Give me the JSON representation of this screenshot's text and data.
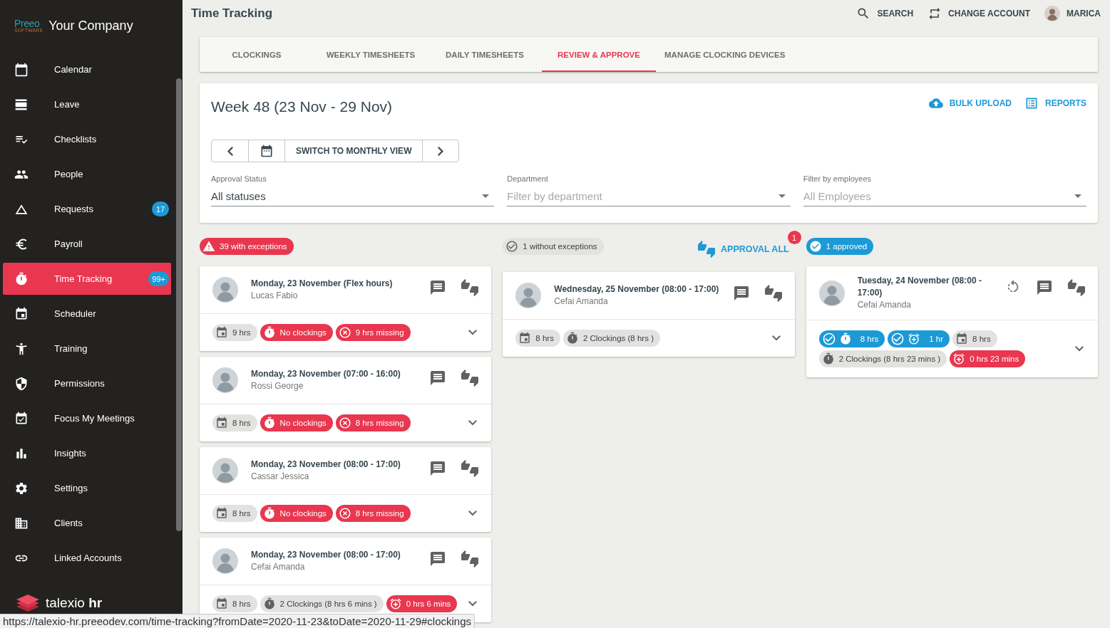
{
  "sidebar": {
    "logo": {
      "wordmark": "Preeo",
      "tagline": "SOFTWARE",
      "company": "Your Company"
    },
    "items": [
      {
        "label": "Calendar",
        "selected": false
      },
      {
        "label": "Leave",
        "selected": false
      },
      {
        "label": "Checklists",
        "selected": false
      },
      {
        "label": "People",
        "selected": false
      },
      {
        "label": "Requests",
        "selected": false,
        "badge": "17"
      },
      {
        "label": "Payroll",
        "selected": false
      },
      {
        "label": "Time Tracking",
        "selected": true,
        "badge": "99+"
      },
      {
        "label": "Scheduler",
        "selected": false
      },
      {
        "label": "Training",
        "selected": false
      },
      {
        "label": "Permissions",
        "selected": false
      },
      {
        "label": "Focus My Meetings",
        "selected": false
      },
      {
        "label": "Insights",
        "selected": false
      },
      {
        "label": "Settings",
        "selected": false
      },
      {
        "label": "Clients",
        "selected": false
      },
      {
        "label": "Linked Accounts",
        "selected": false
      }
    ],
    "brand": "talexio **hr**"
  },
  "top_bar": {
    "title": "Time Tracking",
    "actions": [
      {
        "label": "SEARCH"
      },
      {
        "label": "CHANGE ACCOUNT"
      }
    ],
    "user": "MARICA"
  },
  "tabs": [
    {
      "label": "CLOCKINGS",
      "selected": false
    },
    {
      "label": "WEEKLY TIMESHEETS",
      "selected": false
    },
    {
      "label": "DAILY TIMESHEETS",
      "selected": false
    },
    {
      "label": "REVIEW & APPROVE",
      "selected": true
    },
    {
      "label": "MANAGE CLOCKING DEVICES",
      "selected": false
    }
  ],
  "week": {
    "title": "Week 48 (23 Nov - 29 Nov)",
    "actions": [
      {
        "label": "BULK UPLOAD"
      },
      {
        "label": "REPORTS"
      }
    ],
    "view_switch": "SWITCH TO MONTHLY VIEW",
    "filters": [
      {
        "label": "Approval Status",
        "value": "All statuses"
      },
      {
        "label": "Department",
        "placeholder": "Filter by department"
      },
      {
        "label": "Filter by employees",
        "placeholder": "All Employees"
      }
    ]
  },
  "columns": [
    {
      "kind": "exceptions",
      "chip": "39 with exceptions",
      "cards": [
        {
          "title": "Monday, 23 November (Flex hours)",
          "name": "Lucas Fabio",
          "approved": false,
          "chips": [
            {
              "kind": "hours",
              "text": "9 hrs"
            },
            {
              "kind": "no_clockings",
              "text": "No clockings"
            },
            {
              "kind": "missing",
              "text": "9 hrs missing"
            }
          ]
        },
        {
          "title": "Monday, 23 November (07:00 - 16:00)",
          "name": "Rossi George",
          "approved": false,
          "chips": [
            {
              "kind": "hours",
              "text": "8 hrs"
            },
            {
              "kind": "no_clockings",
              "text": "No clockings"
            },
            {
              "kind": "missing",
              "text": "8 hrs missing"
            }
          ]
        },
        {
          "title": "Monday, 23 November (08:00 - 17:00)",
          "name": "Cassar Jessica",
          "approved": false,
          "chips": [
            {
              "kind": "hours",
              "text": "8 hrs"
            },
            {
              "kind": "no_clockings",
              "text": "No clockings"
            },
            {
              "kind": "missing",
              "text": "8 hrs missing"
            }
          ]
        },
        {
          "title": "Monday, 23 November (08:00 - 17:00)",
          "name": "Cefai Amanda",
          "approved": false,
          "chips": [
            {
              "kind": "hours",
              "text": "8 hrs"
            },
            {
              "kind": "clockings",
              "text": "2 Clockings (8 hrs 6 mins )"
            },
            {
              "kind": "overtime",
              "text": "0 hrs 6 mins"
            }
          ]
        }
      ]
    },
    {
      "kind": "without_exceptions",
      "chip": "1 without exceptions",
      "approve_all": {
        "label": "APPROVAL ALL",
        "badge": "1"
      },
      "cards": [
        {
          "title": "Wednesday, 25 November (08:00 - 17:00)",
          "name": "Cefai Amanda",
          "approved": false,
          "chips": [
            {
              "kind": "hours",
              "text": "8 hrs"
            },
            {
              "kind": "clockings",
              "text": "2 Clockings (8 hrs )"
            }
          ]
        }
      ]
    },
    {
      "kind": "approved",
      "chip": "1 approved",
      "cards": [
        {
          "title": "Tuesday, 24 November (08:00 - 17:00)",
          "name": "Cefai Amanda",
          "approved": true,
          "chips": [
            {
              "kind": "approved_hours",
              "text": "8 hrs"
            },
            {
              "kind": "approved_overtime",
              "text": "1 hr"
            },
            {
              "kind": "hours",
              "text": "8 hrs"
            },
            {
              "kind": "clockings",
              "text": "2 Clockings (8 hrs 23 mins )"
            },
            {
              "kind": "overtime",
              "text": "0 hrs 23 mins"
            }
          ]
        }
      ]
    }
  ],
  "status_bar": {
    "url": "https://talexio-hr.preeodev.com/time-tracking?fromDate=2020-11-23&toDate=2020-11-29#clockings"
  }
}
